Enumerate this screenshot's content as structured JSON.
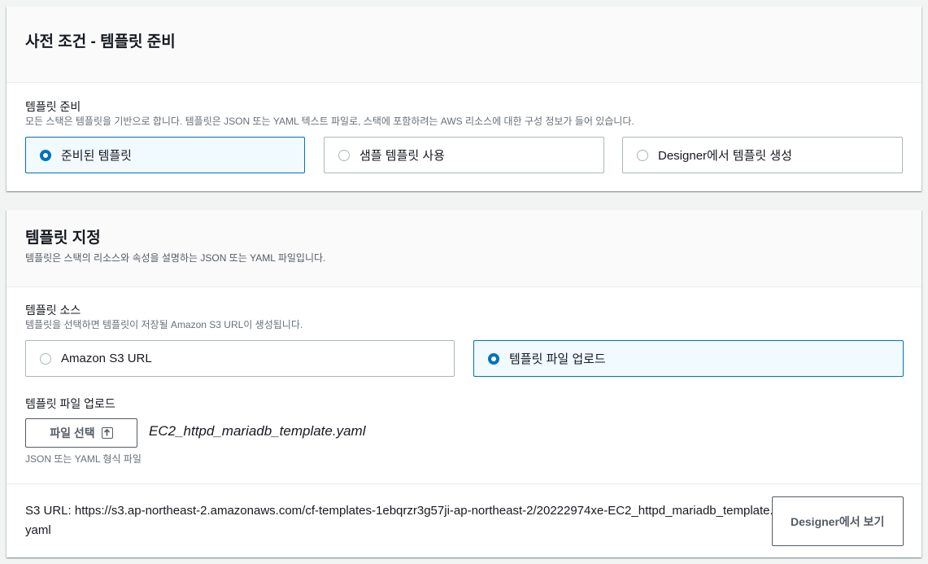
{
  "prerequisite": {
    "title": "사전 조건 - 템플릿 준비",
    "field_label": "템플릿 준비",
    "field_desc": "모든 스택은 템플릿을 기반으로 합니다. 템플릿은 JSON 또는 YAML 텍스트 파일로, 스택에 포함하려는 AWS 리소스에 대한 구성 정보가 들어 있습니다.",
    "options": [
      {
        "label": "준비된 템플릿",
        "selected": true
      },
      {
        "label": "샘플 템플릿 사용",
        "selected": false
      },
      {
        "label": "Designer에서 템플릿 생성",
        "selected": false
      }
    ]
  },
  "specify": {
    "title": "템플릿 지정",
    "desc": "템플릿은 스택의 리소스와 속성을 설명하는 JSON 또는 YAML 파일입니다.",
    "source_label": "템플릿 소스",
    "source_desc": "템플릿을 선택하면 템플릿이 저장될 Amazon S3 URL이 생성됩니다.",
    "source_options": [
      {
        "label": "Amazon S3 URL",
        "selected": false
      },
      {
        "label": "템플릿 파일 업로드",
        "selected": true
      }
    ],
    "upload_label": "템플릿 파일 업로드",
    "choose_file_label": "파일 선택",
    "filename": "EC2_httpd_mariadb_template.yaml",
    "constraint": "JSON 또는 YAML 형식 파일",
    "s3_url_text": "S3 URL:  https://s3.ap-northeast-2.amazonaws.com/cf-templates-1ebqrzr3g57ji-ap-northeast-2/20222974xe-EC2_httpd_mariadb_template.yaml",
    "designer_button": "Designer에서 보기"
  },
  "colors": {
    "accent": "#0073bb",
    "selected_bg": "#f1faff",
    "header_bg": "#fafafa"
  }
}
